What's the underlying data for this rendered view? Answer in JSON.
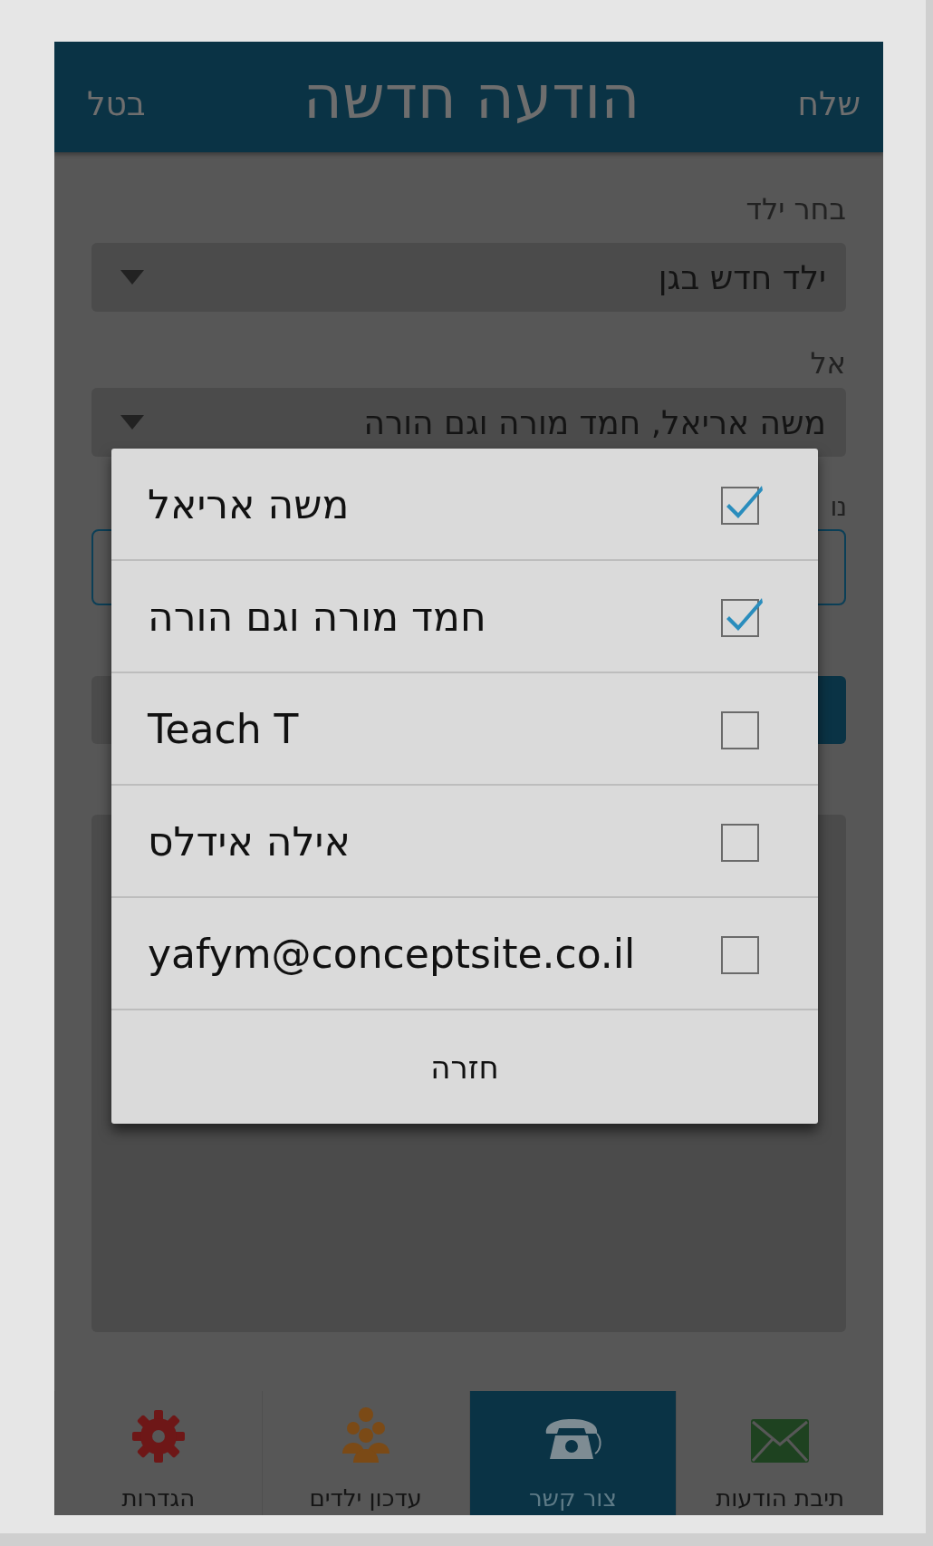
{
  "header": {
    "send": "שלח",
    "title": "הודעה חדשה",
    "cancel": "בטל"
  },
  "form": {
    "child_label": "בחר ילד",
    "child_value": "ילד חדש בגן",
    "to_label": "אל",
    "to_value": "משה אריאל, חמד מורה וגם הורה",
    "subject_label": "נו"
  },
  "dialog": {
    "items": [
      {
        "label": "משה אריאל",
        "checked": true
      },
      {
        "label": "חמד מורה וגם הורה",
        "checked": true
      },
      {
        "label": "Teach T",
        "checked": false
      },
      {
        "label": "אילה אידלס",
        "checked": false
      },
      {
        "label": "yafym@conceptsite.co.il",
        "checked": false
      }
    ],
    "button": "חזרה"
  },
  "nav": [
    {
      "label": "תיבת הודעות",
      "selected": false
    },
    {
      "label": "צור קשר",
      "selected": true
    },
    {
      "label": "עדכון ילדים",
      "selected": false
    },
    {
      "label": "הגדרות",
      "selected": false
    }
  ]
}
